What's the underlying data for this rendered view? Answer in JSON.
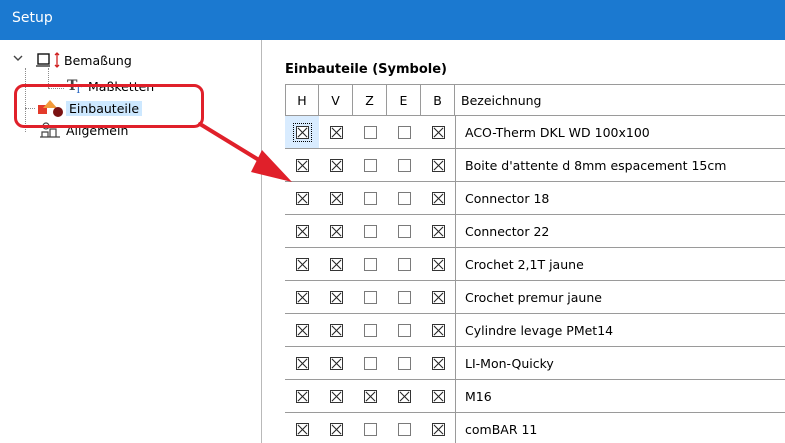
{
  "window": {
    "title": "Setup"
  },
  "tree": {
    "items": [
      {
        "label": "Bemaßung",
        "icon": "dimension-icon"
      },
      {
        "label": "Maßketten",
        "icon": "dimension-chain-icon"
      },
      {
        "label": "Einbauteile",
        "icon": "components-icon",
        "selected": true
      },
      {
        "label": "Allgemein",
        "icon": "general-settings-icon"
      }
    ]
  },
  "grid": {
    "title": "Einbauteile (Symbole)",
    "columns": [
      "H",
      "V",
      "Z",
      "E",
      "B",
      "Bezeichnung"
    ],
    "rows": [
      {
        "name": "ACO-Therm DKL WD 100x100",
        "checks": [
          true,
          true,
          false,
          false,
          true
        ]
      },
      {
        "name": "Boite d'attente d 8mm espacement 15cm",
        "checks": [
          true,
          true,
          false,
          false,
          true
        ]
      },
      {
        "name": "Connector 18",
        "checks": [
          true,
          true,
          false,
          false,
          true
        ]
      },
      {
        "name": "Connector 22",
        "checks": [
          true,
          true,
          false,
          false,
          true
        ]
      },
      {
        "name": "Crochet 2,1T jaune",
        "checks": [
          true,
          true,
          false,
          false,
          true
        ]
      },
      {
        "name": "Crochet premur jaune",
        "checks": [
          true,
          true,
          false,
          false,
          true
        ]
      },
      {
        "name": "Cylindre levage PMet14",
        "checks": [
          true,
          true,
          false,
          false,
          true
        ]
      },
      {
        "name": "LI-Mon-Quicky",
        "checks": [
          true,
          true,
          false,
          false,
          true
        ]
      },
      {
        "name": "M16",
        "checks": [
          true,
          true,
          true,
          true,
          true
        ]
      },
      {
        "name": "comBAR 11",
        "checks": [
          true,
          true,
          false,
          false,
          true
        ]
      }
    ]
  },
  "colors": {
    "titlebar": "#1b79d0",
    "annotation": "#e0202a",
    "selection": "#cde8ff"
  }
}
